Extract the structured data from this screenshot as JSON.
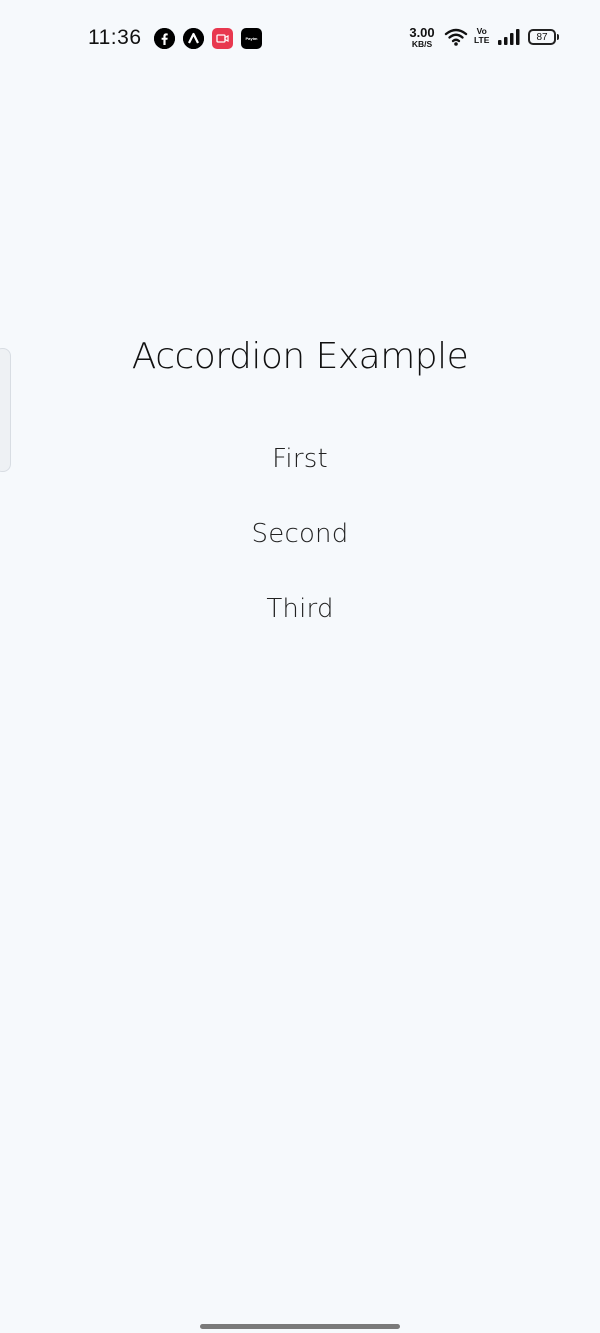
{
  "status_bar": {
    "time": "11:36",
    "notification_icons": [
      "facebook-icon",
      "app-a-icon",
      "screen-recorder-icon",
      "paytm-icon"
    ],
    "paytm_text": "Paytm",
    "net_speed_value": "3.00",
    "net_speed_unit": "KB/S",
    "volte_line1": "Vo",
    "volte_line2": "LTE",
    "battery_level": "87"
  },
  "main": {
    "title": "Accordion Example",
    "accordion_items": [
      "First",
      "Second",
      "Third"
    ]
  },
  "colors": {
    "background": "#f6f9fc",
    "text": "#111111",
    "recorder_icon": "#e8384f"
  }
}
